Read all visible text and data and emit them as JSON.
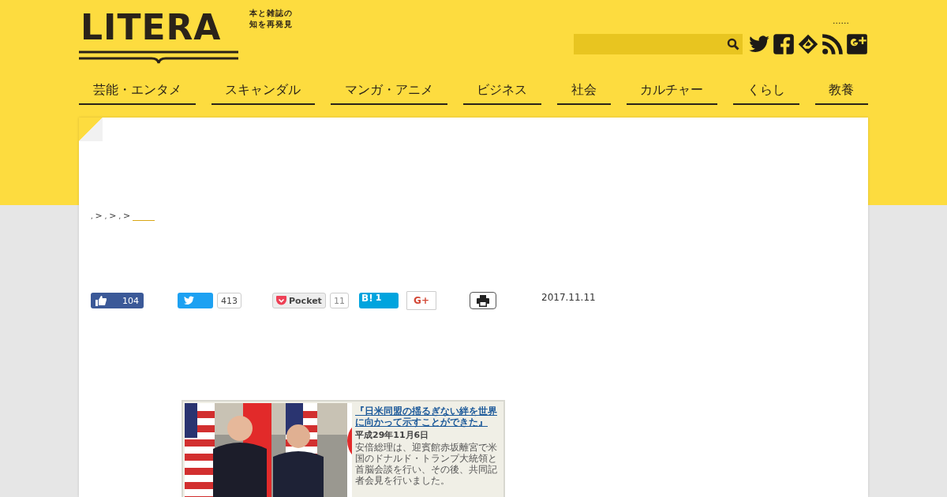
{
  "logo": {
    "name": "LITERA",
    "tagline": [
      "本と雑誌の",
      "知を再発見"
    ]
  },
  "header_link": "......",
  "nav": [
    {
      "label": "芸能・エンタメ"
    },
    {
      "label": "スキャンダル"
    },
    {
      "label": "マンガ・アニメ"
    },
    {
      "label": "ビジネス"
    },
    {
      "label": "社会"
    },
    {
      "label": "カルチャー"
    },
    {
      "label": "くらし"
    },
    {
      "label": "教養"
    }
  ],
  "breadcrumb": [
    ",",
    ">",
    ",",
    ">",
    ",",
    ">"
  ],
  "share": [
    {
      "kind": "like",
      "count": "104"
    },
    {
      "kind": "tweet",
      "count": "413"
    },
    {
      "kind": "pocket",
      "label": "Pocket",
      "count": "11"
    },
    {
      "kind": "hatena",
      "label": "B!",
      "count": "1"
    },
    {
      "kind": "gplus",
      "label": "G+"
    },
    {
      "kind": "print"
    }
  ],
  "date": "2017.11.11",
  "figure": {
    "kind": "picture",
    "headline": "『日米同盟の揺るぎない絆を世界に向かって示すことができた』",
    "date": "平成29年11月6日",
    "body": "安倍総理は、迎賓館赤坂離宮で米国のドナルド・トランプ大統領と首脳会談を行い、その後、共同記者会見を行いました。"
  }
}
